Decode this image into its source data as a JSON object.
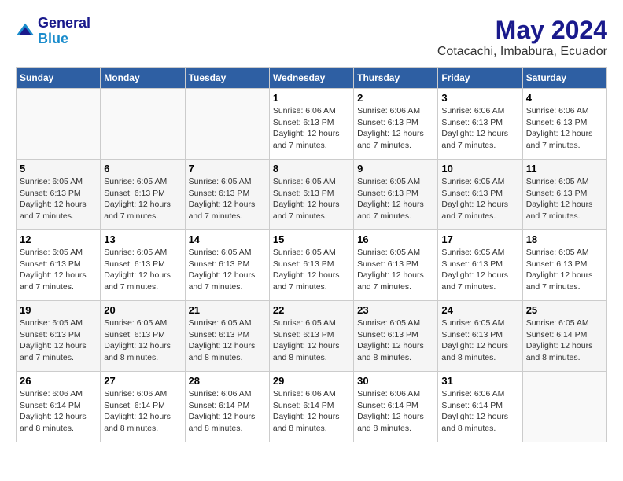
{
  "header": {
    "logo_line1": "General",
    "logo_line2": "Blue",
    "title": "May 2024",
    "subtitle": "Cotacachi, Imbabura, Ecuador"
  },
  "days_of_week": [
    "Sunday",
    "Monday",
    "Tuesday",
    "Wednesday",
    "Thursday",
    "Friday",
    "Saturday"
  ],
  "weeks": [
    [
      {
        "day": "",
        "info": ""
      },
      {
        "day": "",
        "info": ""
      },
      {
        "day": "",
        "info": ""
      },
      {
        "day": "1",
        "info": "Sunrise: 6:06 AM\nSunset: 6:13 PM\nDaylight: 12 hours\nand 7 minutes."
      },
      {
        "day": "2",
        "info": "Sunrise: 6:06 AM\nSunset: 6:13 PM\nDaylight: 12 hours\nand 7 minutes."
      },
      {
        "day": "3",
        "info": "Sunrise: 6:06 AM\nSunset: 6:13 PM\nDaylight: 12 hours\nand 7 minutes."
      },
      {
        "day": "4",
        "info": "Sunrise: 6:06 AM\nSunset: 6:13 PM\nDaylight: 12 hours\nand 7 minutes."
      }
    ],
    [
      {
        "day": "5",
        "info": "Sunrise: 6:05 AM\nSunset: 6:13 PM\nDaylight: 12 hours\nand 7 minutes."
      },
      {
        "day": "6",
        "info": "Sunrise: 6:05 AM\nSunset: 6:13 PM\nDaylight: 12 hours\nand 7 minutes."
      },
      {
        "day": "7",
        "info": "Sunrise: 6:05 AM\nSunset: 6:13 PM\nDaylight: 12 hours\nand 7 minutes."
      },
      {
        "day": "8",
        "info": "Sunrise: 6:05 AM\nSunset: 6:13 PM\nDaylight: 12 hours\nand 7 minutes."
      },
      {
        "day": "9",
        "info": "Sunrise: 6:05 AM\nSunset: 6:13 PM\nDaylight: 12 hours\nand 7 minutes."
      },
      {
        "day": "10",
        "info": "Sunrise: 6:05 AM\nSunset: 6:13 PM\nDaylight: 12 hours\nand 7 minutes."
      },
      {
        "day": "11",
        "info": "Sunrise: 6:05 AM\nSunset: 6:13 PM\nDaylight: 12 hours\nand 7 minutes."
      }
    ],
    [
      {
        "day": "12",
        "info": "Sunrise: 6:05 AM\nSunset: 6:13 PM\nDaylight: 12 hours\nand 7 minutes."
      },
      {
        "day": "13",
        "info": "Sunrise: 6:05 AM\nSunset: 6:13 PM\nDaylight: 12 hours\nand 7 minutes."
      },
      {
        "day": "14",
        "info": "Sunrise: 6:05 AM\nSunset: 6:13 PM\nDaylight: 12 hours\nand 7 minutes."
      },
      {
        "day": "15",
        "info": "Sunrise: 6:05 AM\nSunset: 6:13 PM\nDaylight: 12 hours\nand 7 minutes."
      },
      {
        "day": "16",
        "info": "Sunrise: 6:05 AM\nSunset: 6:13 PM\nDaylight: 12 hours\nand 7 minutes."
      },
      {
        "day": "17",
        "info": "Sunrise: 6:05 AM\nSunset: 6:13 PM\nDaylight: 12 hours\nand 7 minutes."
      },
      {
        "day": "18",
        "info": "Sunrise: 6:05 AM\nSunset: 6:13 PM\nDaylight: 12 hours\nand 7 minutes."
      }
    ],
    [
      {
        "day": "19",
        "info": "Sunrise: 6:05 AM\nSunset: 6:13 PM\nDaylight: 12 hours\nand 7 minutes."
      },
      {
        "day": "20",
        "info": "Sunrise: 6:05 AM\nSunset: 6:13 PM\nDaylight: 12 hours\nand 8 minutes."
      },
      {
        "day": "21",
        "info": "Sunrise: 6:05 AM\nSunset: 6:13 PM\nDaylight: 12 hours\nand 8 minutes."
      },
      {
        "day": "22",
        "info": "Sunrise: 6:05 AM\nSunset: 6:13 PM\nDaylight: 12 hours\nand 8 minutes."
      },
      {
        "day": "23",
        "info": "Sunrise: 6:05 AM\nSunset: 6:13 PM\nDaylight: 12 hours\nand 8 minutes."
      },
      {
        "day": "24",
        "info": "Sunrise: 6:05 AM\nSunset: 6:13 PM\nDaylight: 12 hours\nand 8 minutes."
      },
      {
        "day": "25",
        "info": "Sunrise: 6:05 AM\nSunset: 6:14 PM\nDaylight: 12 hours\nand 8 minutes."
      }
    ],
    [
      {
        "day": "26",
        "info": "Sunrise: 6:06 AM\nSunset: 6:14 PM\nDaylight: 12 hours\nand 8 minutes."
      },
      {
        "day": "27",
        "info": "Sunrise: 6:06 AM\nSunset: 6:14 PM\nDaylight: 12 hours\nand 8 minutes."
      },
      {
        "day": "28",
        "info": "Sunrise: 6:06 AM\nSunset: 6:14 PM\nDaylight: 12 hours\nand 8 minutes."
      },
      {
        "day": "29",
        "info": "Sunrise: 6:06 AM\nSunset: 6:14 PM\nDaylight: 12 hours\nand 8 minutes."
      },
      {
        "day": "30",
        "info": "Sunrise: 6:06 AM\nSunset: 6:14 PM\nDaylight: 12 hours\nand 8 minutes."
      },
      {
        "day": "31",
        "info": "Sunrise: 6:06 AM\nSunset: 6:14 PM\nDaylight: 12 hours\nand 8 minutes."
      },
      {
        "day": "",
        "info": ""
      }
    ]
  ]
}
